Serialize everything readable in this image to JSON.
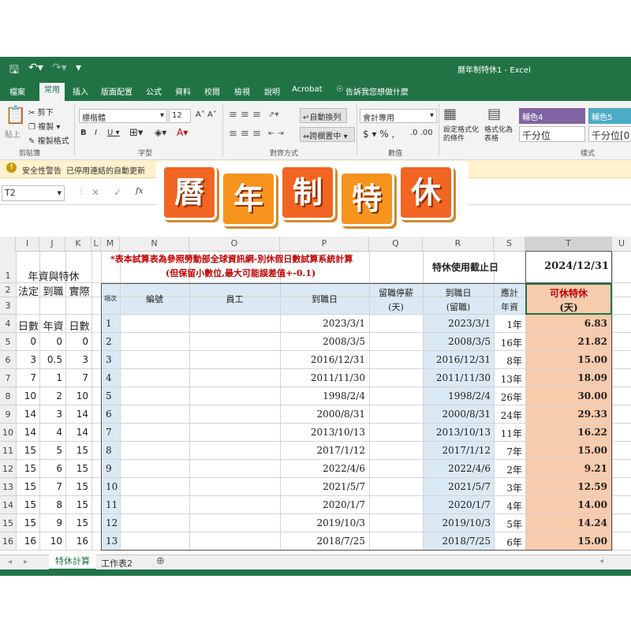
{
  "window": {
    "title": "曆年制特休1 - Excel"
  },
  "tabs": [
    "檔案",
    "常用",
    "插入",
    "版面配置",
    "公式",
    "資料",
    "校閱",
    "檢視",
    "說明",
    "Acrobat"
  ],
  "tell_me": "告訴我您想做什麼",
  "ribbon": {
    "cut": "剪下",
    "copy": "複製",
    "format_painter": "複製格式",
    "paste": "貼上",
    "font_name": "標楷體",
    "font_size": "12",
    "wrap_text": "自動換列",
    "merge_center": "跨欄置中",
    "number_format": "會計專用",
    "cond_format": "設定格式化的條件",
    "format_table": "格式化為表格",
    "style1": "輔色4",
    "style2": "輔色5",
    "style3": "千分位",
    "style4": "千分位[0",
    "groups": [
      "剪貼簿",
      "字型",
      "對齊方式",
      "數值",
      "樣式"
    ]
  },
  "security": {
    "title": "安全性警告",
    "message": "已停用連結的自動更新"
  },
  "formula_bar": {
    "name_box": "T2",
    "fx": "fx"
  },
  "banner": [
    "曆",
    "年",
    "制",
    "特",
    "休"
  ],
  "columns": [
    "I",
    "J",
    "K",
    "L",
    "M",
    "N",
    "O",
    "P",
    "Q",
    "R",
    "S",
    "T"
  ],
  "note": {
    "line1": "*表本試算表為參照勞動部全球資訊網-別休假日數試算系統計算",
    "line2": "(但保留小數位,最大可能誤差值+-0.1)"
  },
  "cutoff_label": "特休使用截止日",
  "cutoff_date": "2024/12/31",
  "left_table": {
    "title": "年資與特休",
    "head1": [
      "法定",
      "到職",
      "實際"
    ],
    "head2": [
      "日數",
      "年資",
      "日數"
    ],
    "rows": [
      [
        "0",
        "0",
        "0"
      ],
      [
        "3",
        "0.5",
        "3"
      ],
      [
        "7",
        "1",
        "7"
      ],
      [
        "10",
        "2",
        "10"
      ],
      [
        "14",
        "3",
        "14"
      ],
      [
        "14",
        "4",
        "14"
      ],
      [
        "15",
        "5",
        "15"
      ],
      [
        "15",
        "6",
        "15"
      ],
      [
        "15",
        "7",
        "15"
      ],
      [
        "15",
        "8",
        "15"
      ],
      [
        "15",
        "9",
        "15"
      ],
      [
        "16",
        "10",
        "16"
      ]
    ]
  },
  "main_headers": {
    "seq": "項次",
    "id": "編號",
    "employee": "員工",
    "hire_date": "到職日",
    "unpaid_leave": "留職停薪",
    "unpaid_leave_unit": "(天)",
    "hire_date2": "到職日",
    "hire_date2_sub": "(留職)",
    "seniority": "應計",
    "seniority_sub": "年資",
    "leave": "可休特休",
    "leave_unit": "(天)"
  },
  "rows_numbers": [
    "1",
    "2",
    "3",
    "4",
    "5",
    "6",
    "7",
    "8",
    "9",
    "10",
    "11",
    "12",
    "13",
    "14",
    "15",
    "16"
  ],
  "employees": [
    {
      "n": "1",
      "date": "2023/3/1",
      "date2": "2023/3/1",
      "years": "1年",
      "days": "6.83"
    },
    {
      "n": "2",
      "date": "2008/3/5",
      "date2": "2008/3/5",
      "years": "16年",
      "days": "21.82"
    },
    {
      "n": "3",
      "date": "2016/12/31",
      "date2": "2016/12/31",
      "years": "8年",
      "days": "15.00"
    },
    {
      "n": "4",
      "date": "2011/11/30",
      "date2": "2011/11/30",
      "years": "13年",
      "days": "18.09"
    },
    {
      "n": "5",
      "date": "1998/2/4",
      "date2": "1998/2/4",
      "years": "26年",
      "days": "30.00"
    },
    {
      "n": "6",
      "date": "2000/8/31",
      "date2": "2000/8/31",
      "years": "24年",
      "days": "29.33"
    },
    {
      "n": "7",
      "date": "2013/10/13",
      "date2": "2013/10/13",
      "years": "11年",
      "days": "16.22"
    },
    {
      "n": "8",
      "date": "2017/1/12",
      "date2": "2017/1/12",
      "years": "7年",
      "days": "15.00"
    },
    {
      "n": "9",
      "date": "2022/4/6",
      "date2": "2022/4/6",
      "years": "2年",
      "days": "9.21"
    },
    {
      "n": "10",
      "date": "2021/5/7",
      "date2": "2021/5/7",
      "years": "3年",
      "days": "12.59"
    },
    {
      "n": "11",
      "date": "2020/1/7",
      "date2": "2020/1/7",
      "years": "4年",
      "days": "14.00"
    },
    {
      "n": "12",
      "date": "2019/10/3",
      "date2": "2019/10/3",
      "years": "5年",
      "days": "14.24"
    },
    {
      "n": "13",
      "date": "2018/7/25",
      "date2": "2018/7/25",
      "years": "6年",
      "days": "15.00"
    }
  ],
  "sheet_tabs": [
    "特休計算",
    "工作表2"
  ],
  "colors": {
    "excel_green": "#217346",
    "red_note": "#c00000",
    "blue_fill": "#dbe9f4",
    "orange_fill": "#f8cbad",
    "banner_orange": "#f26522"
  }
}
